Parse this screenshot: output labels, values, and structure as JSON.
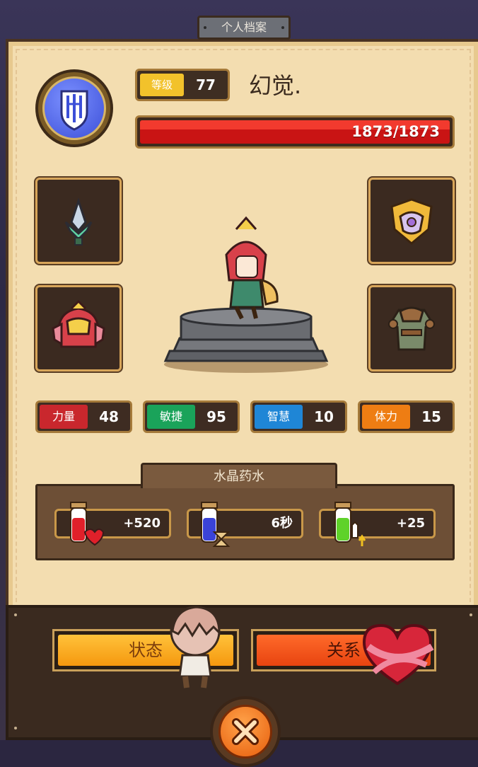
{
  "window": {
    "title": "个人档案"
  },
  "player": {
    "level_label": "等级",
    "level": "77",
    "name": "幻觉.",
    "hp_text": "1873/1873",
    "hp_fraction": 1.0
  },
  "equipment": [
    {
      "slot": "weapon",
      "icon": "spear-tip-icon"
    },
    {
      "slot": "accessory",
      "icon": "gem-crest-icon"
    },
    {
      "slot": "helmet",
      "icon": "red-helmet-icon"
    },
    {
      "slot": "armor",
      "icon": "leather-armor-icon"
    }
  ],
  "stats": [
    {
      "label": "力量",
      "value": "48",
      "color": "#c9272d"
    },
    {
      "label": "敏捷",
      "value": "95",
      "color": "#1aa35a"
    },
    {
      "label": "智慧",
      "value": "10",
      "color": "#1f86d6"
    },
    {
      "label": "体力",
      "value": "15",
      "color": "#ee7d13"
    }
  ],
  "potions": {
    "title": "水晶药水",
    "items": [
      {
        "icon": "heal-potion-icon",
        "value": "+520"
      },
      {
        "icon": "time-potion-icon",
        "value": "6秒"
      },
      {
        "icon": "power-potion-icon",
        "value": "+25"
      }
    ]
  },
  "buttons": {
    "status": "状态",
    "relation": "关系"
  },
  "colors": {
    "panel": "#f3ddb0",
    "frame": "#4a3322",
    "hp_red": "#c91414",
    "status_button": "#f7a21b",
    "relation_button": "#f1501a"
  }
}
